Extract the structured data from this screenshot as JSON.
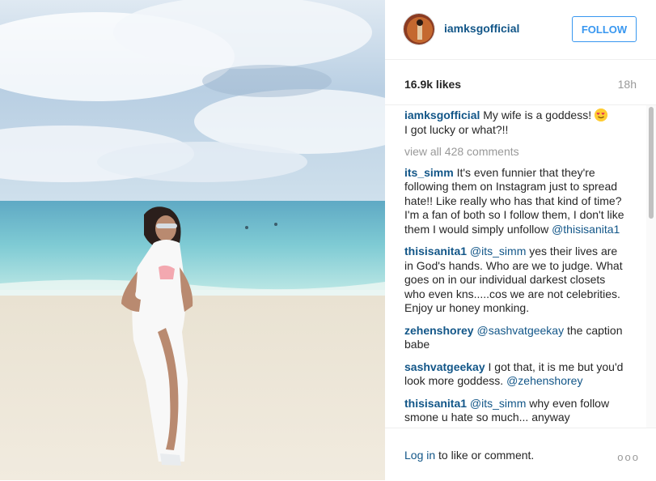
{
  "post": {
    "username": "iamksgofficial",
    "follow_label": "FOLLOW",
    "likes": "16.9k likes",
    "age": "18h"
  },
  "caption": {
    "username": "iamksgofficial",
    "text_before": "My wife is a goddess!",
    "text_after": "I got lucky or what?!!"
  },
  "view_all": "view all 428 comments",
  "comments": [
    {
      "user": "its_simm",
      "text": "It's even funnier that they're following them on Instagram just to spread hate!! Like really who has that kind of time? I'm a fan of both so I follow them, I don't like them I would simply unfollow",
      "mention": "@thisisanita1",
      "after": ""
    },
    {
      "user": "thisisanita1",
      "text": "",
      "mention": "@its_simm",
      "after": "yes their lives are in God's hands. Who are we to judge. What goes on in our individual darkest closets who even kns.....cos we are not celebrities. Enjoy ur honey monking."
    },
    {
      "user": "zehenshorey",
      "text": "",
      "mention": "@sashvatgeekay",
      "after": "the caption babe"
    },
    {
      "user": "sashvatgeekay",
      "text": "I got that, it is me but you'd look more goddess.",
      "mention": "@zehenshorey",
      "after": ""
    },
    {
      "user": "thisisanita1",
      "text": "",
      "mention": "@its_simm",
      "after": "why even follow smone u hate so much... anyway"
    }
  ],
  "footer": {
    "login_link": "Log in",
    "login_rest": "to like or comment.",
    "more": "ooo"
  },
  "colors": {
    "accent": "#3897f0",
    "username": "#125688",
    "muted": "#999999"
  },
  "icons": [
    "heart-eyes-emoji",
    "more-options-icon"
  ]
}
